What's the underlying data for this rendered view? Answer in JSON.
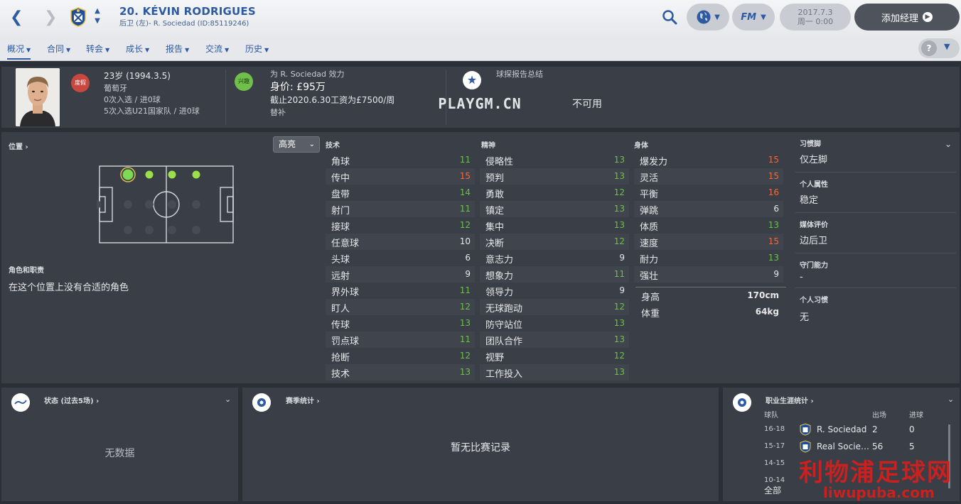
{
  "header": {
    "back": "❮",
    "forward": "❯",
    "title": "20. KÉVIN RODRIGUES",
    "subtitle": "后卫 (左)- R. Sociedad (ID:85119246)",
    "date": "2017.7.3",
    "time": "周一 0:00",
    "fm_label": "FM",
    "add_manager": "添加经理"
  },
  "tabs": [
    {
      "label": "概况"
    },
    {
      "label": "合同"
    },
    {
      "label": "转会"
    },
    {
      "label": "成长"
    },
    {
      "label": "报告"
    },
    {
      "label": "交流"
    },
    {
      "label": "历史"
    }
  ],
  "info": {
    "holiday_badge": "度假",
    "age": "23岁 (1994.3.5)",
    "nationality": "葡萄牙",
    "caps": "0次入选 / 进0球",
    "u21_caps": "5次入选U21国家队 / 进0球",
    "interest_badge": "兴趣",
    "club_line": "为 R. Sociedad 效力",
    "value": "身价: £95万",
    "contract": "截止2020.6.30工资为£7500/周",
    "squad_role": "替补",
    "scout_title": "球探报告总结",
    "scout_value": "不可用"
  },
  "position": {
    "label": "位置",
    "highlight": "高亮",
    "roles_label": "角色和职责",
    "roles_value": "在这个位置上没有合适的角色"
  },
  "attributes": {
    "technical_label": "技术",
    "mental_label": "精神",
    "physical_label": "身体",
    "technical": [
      {
        "name": "角球",
        "value": "11",
        "tier": "green"
      },
      {
        "name": "传中",
        "value": "15",
        "tier": "orange"
      },
      {
        "name": "盘带",
        "value": "14",
        "tier": "green"
      },
      {
        "name": "射门",
        "value": "11",
        "tier": "green"
      },
      {
        "name": "接球",
        "value": "12",
        "tier": "green"
      },
      {
        "name": "任意球",
        "value": "10",
        "tier": "white"
      },
      {
        "name": "头球",
        "value": "6",
        "tier": "white"
      },
      {
        "name": "远射",
        "value": "9",
        "tier": "white"
      },
      {
        "name": "界外球",
        "value": "11",
        "tier": "green"
      },
      {
        "name": "盯人",
        "value": "12",
        "tier": "green"
      },
      {
        "name": "传球",
        "value": "13",
        "tier": "green"
      },
      {
        "name": "罚点球",
        "value": "11",
        "tier": "green"
      },
      {
        "name": "抢断",
        "value": "12",
        "tier": "green"
      },
      {
        "name": "技术",
        "value": "13",
        "tier": "green"
      }
    ],
    "mental": [
      {
        "name": "侵略性",
        "value": "13",
        "tier": "green"
      },
      {
        "name": "预判",
        "value": "13",
        "tier": "green"
      },
      {
        "name": "勇敢",
        "value": "12",
        "tier": "green"
      },
      {
        "name": "镇定",
        "value": "13",
        "tier": "green"
      },
      {
        "name": "集中",
        "value": "13",
        "tier": "green"
      },
      {
        "name": "决断",
        "value": "12",
        "tier": "green"
      },
      {
        "name": "意志力",
        "value": "9",
        "tier": "white"
      },
      {
        "name": "想象力",
        "value": "11",
        "tier": "green"
      },
      {
        "name": "领导力",
        "value": "9",
        "tier": "white"
      },
      {
        "name": "无球跑动",
        "value": "12",
        "tier": "green"
      },
      {
        "name": "防守站位",
        "value": "13",
        "tier": "green"
      },
      {
        "name": "团队合作",
        "value": "13",
        "tier": "green"
      },
      {
        "name": "视野",
        "value": "12",
        "tier": "green"
      },
      {
        "name": "工作投入",
        "value": "13",
        "tier": "green"
      }
    ],
    "physical": [
      {
        "name": "爆发力",
        "value": "15",
        "tier": "orange"
      },
      {
        "name": "灵活",
        "value": "15",
        "tier": "orange"
      },
      {
        "name": "平衡",
        "value": "16",
        "tier": "orange"
      },
      {
        "name": "弹跳",
        "value": "6",
        "tier": "white"
      },
      {
        "name": "体质",
        "value": "13",
        "tier": "green"
      },
      {
        "name": "速度",
        "value": "15",
        "tier": "orange"
      },
      {
        "name": "耐力",
        "value": "13",
        "tier": "green"
      },
      {
        "name": "强壮",
        "value": "9",
        "tier": "white"
      }
    ],
    "height_label": "身高",
    "height": "170cm",
    "weight_label": "体重",
    "weight": "64kg"
  },
  "side": [
    {
      "label": "习惯脚",
      "value": "仅左脚"
    },
    {
      "label": "个人属性",
      "value": "稳定"
    },
    {
      "label": "媒体评价",
      "value": "边后卫"
    },
    {
      "label": "守门能力",
      "value": "-"
    },
    {
      "label": "个人习惯",
      "value": "无"
    }
  ],
  "form": {
    "title": "状态 (过去5场)",
    "empty": "无数据"
  },
  "season": {
    "title": "赛季统计",
    "empty": "暂无比赛记录"
  },
  "career": {
    "title": "职业生涯统计",
    "col_club": "球队",
    "col_apps": "出场",
    "col_goals": "进球",
    "rows": [
      {
        "season": "16-18",
        "club": "R. Sociedad",
        "apps": "2",
        "goals": "0"
      },
      {
        "season": "15-17",
        "club": "Real Socie…",
        "apps": "56",
        "goals": "5"
      },
      {
        "season": "14-15",
        "club": "",
        "apps": "",
        "goals": ""
      },
      {
        "season": "10-14",
        "club": "",
        "apps": "",
        "goals": ""
      }
    ],
    "total_label": "全部"
  },
  "watermarks": {
    "playgm": "PLAYGM.CN",
    "site_cn": "利物浦足球网",
    "site_url": "liwupuba.com"
  },
  "colors": {
    "accent": "#2d5aa0",
    "green": "#6cc04a",
    "orange": "#ef6b3c",
    "panel": "#3a3e46"
  }
}
